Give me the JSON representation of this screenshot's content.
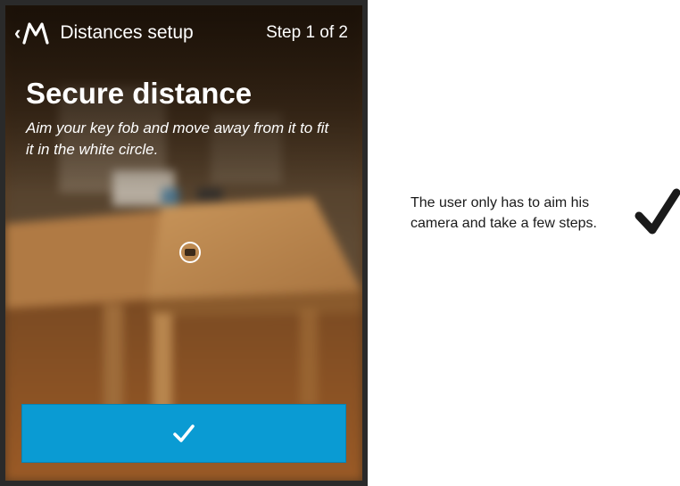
{
  "header": {
    "back_icon": "chevron-left-icon",
    "logo_icon": "motorola-logo-icon",
    "title": "Distances setup",
    "step": "Step 1 of 2"
  },
  "main": {
    "title": "Secure distance",
    "instructions": "Aim your key fob and move away from it to fit it in the white circle."
  },
  "confirm_button": {
    "icon": "checkmark-icon",
    "color": "#0a9bd3"
  },
  "annotation": {
    "caption": "The user only has to aim his camera and take a few steps.",
    "icon": "checkmark-icon"
  }
}
